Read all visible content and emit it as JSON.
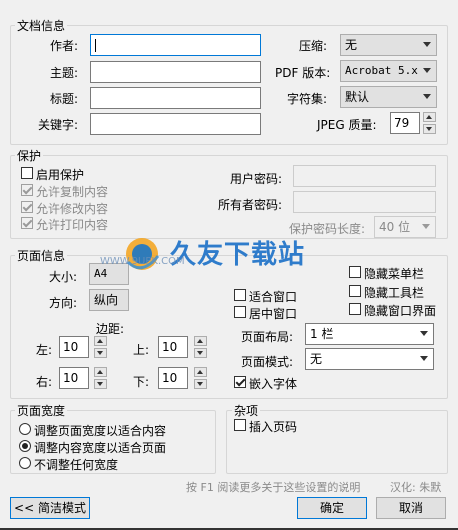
{
  "doc_info": {
    "title": "文档信息",
    "author_label": "作者:",
    "subject_label": "主题:",
    "title_label": "标题:",
    "keywords_label": "关键字:",
    "compress_label": "压缩:",
    "compress_value": "无",
    "pdf_version_label": "PDF 版本:",
    "pdf_version_value": "Acrobat 5.x",
    "charset_label": "字符集:",
    "charset_value": "默认",
    "jpeg_label": "JPEG 质量:",
    "jpeg_value": "79"
  },
  "protect": {
    "title": "保护",
    "enable_label": "启用保护",
    "allow_copy_label": "允许复制内容",
    "allow_modify_label": "允许修改内容",
    "allow_print_label": "允许打印内容",
    "user_pwd_label": "用户密码:",
    "owner_pwd_label": "所有者密码:",
    "pwd_length_label": "保护密码长度:",
    "pwd_length_value": "40 位"
  },
  "page_info": {
    "title": "页面信息",
    "size_label": "大小:",
    "size_value": "A4",
    "direction_label": "方向:",
    "direction_value": "纵向",
    "margin_label": "边距:",
    "left_label": "左:",
    "left_value": "10",
    "top_label": "上:",
    "top_value": "10",
    "right_label": "右:",
    "right_value": "10",
    "bottom_label": "下:",
    "bottom_value": "10",
    "hide_menu_label": "隐藏菜单栏",
    "hide_toolbar_label": "隐藏工具栏",
    "hide_window_ui_label": "隐藏窗口界面",
    "fit_window_label": "适合窗口",
    "center_window_label": "居中窗口",
    "layout_label": "页面布局:",
    "layout_value": "1 栏",
    "mode_label": "页面模式:",
    "mode_value": "无",
    "embed_fonts_label": "嵌入字体"
  },
  "page_width": {
    "title": "页面宽度",
    "option1": "调整页面宽度以适合内容",
    "option2": "调整内容宽度以适合页面",
    "option3": "不调整任何宽度"
  },
  "misc": {
    "title": "杂项",
    "insert_page_num_label": "插入页码"
  },
  "hint_text": "按 F1 阅读更多关于这些设置的说明",
  "credit_text": "汉化: 朱默",
  "buttons": {
    "simple_mode": "<< 简洁模式",
    "ok": "确定",
    "cancel": "取消"
  },
  "watermark": {
    "brand": "久友下载站",
    "url": "WWW.9UPK.COM"
  }
}
